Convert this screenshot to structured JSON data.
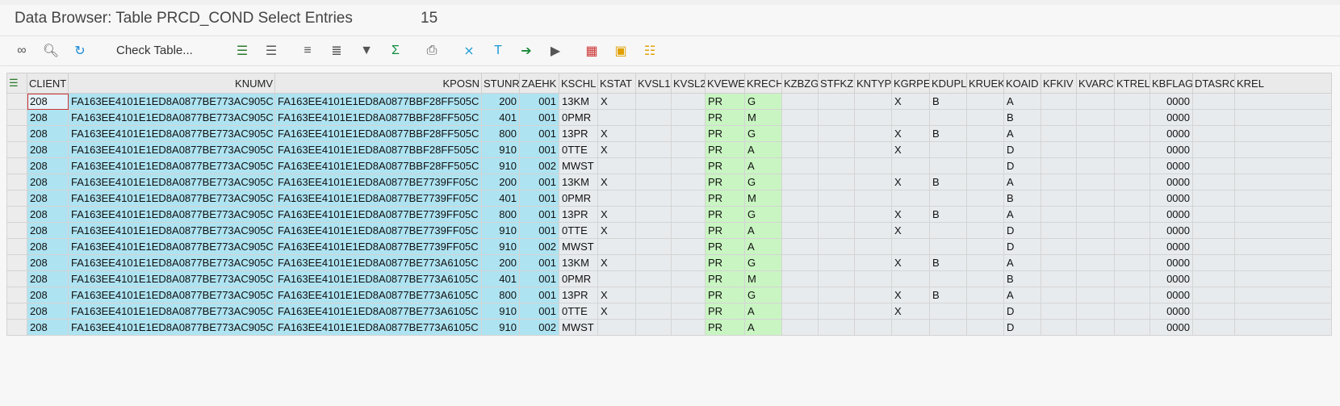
{
  "header": {
    "title": "Data Browser: Table PRCD_COND Select Entries",
    "count": "15"
  },
  "toolbar": {
    "check_table_label": "Check Table...",
    "icons": [
      "glasses-icon",
      "select-document-icon",
      "refresh-icon",
      "select-layout-icon",
      "choose-detail-icon",
      "sort-ascending-icon",
      "sort-descending-icon",
      "filter-icon",
      "sum-icon",
      "print-icon",
      "export-excel-icon",
      "word-processing-icon",
      "local-file-icon",
      "abc-analysis-icon",
      "layout-grid-icon",
      "key-columns-icon",
      "hierarchy-icon"
    ]
  },
  "table": {
    "columns": [
      "CLIENT",
      "KNUMV",
      "KPOSN",
      "STUNR",
      "ZAEHK",
      "KSCHL",
      "KSTAT",
      "KVSL1",
      "KVSL2",
      "KVEWE",
      "KRECH",
      "KZBZG",
      "STFKZ",
      "KNTYP",
      "KGRPE",
      "KDUPL",
      "KRUEK",
      "KOAID",
      "KFKIV",
      "KVARC",
      "KTREL",
      "KBFLAG",
      "DTASRC",
      "KREL"
    ],
    "rows": [
      [
        "208",
        "FA163EE4101E1ED8A0877BE773AC905C",
        "FA163EE4101E1ED8A0877BBF28FF505C",
        "200",
        "001",
        "13KM",
        "X",
        "",
        "",
        "PR",
        "G",
        "",
        "",
        "",
        "X",
        "B",
        "",
        "A",
        "",
        "",
        "",
        "0000",
        "",
        ""
      ],
      [
        "208",
        "FA163EE4101E1ED8A0877BE773AC905C",
        "FA163EE4101E1ED8A0877BBF28FF505C",
        "401",
        "001",
        "0PMR",
        "",
        "",
        "",
        "PR",
        "M",
        "",
        "",
        "",
        "",
        "",
        "",
        "B",
        "",
        "",
        "",
        "0000",
        "",
        ""
      ],
      [
        "208",
        "FA163EE4101E1ED8A0877BE773AC905C",
        "FA163EE4101E1ED8A0877BBF28FF505C",
        "800",
        "001",
        "13PR",
        "X",
        "",
        "",
        "PR",
        "G",
        "",
        "",
        "",
        "X",
        "B",
        "",
        "A",
        "",
        "",
        "",
        "0000",
        "",
        ""
      ],
      [
        "208",
        "FA163EE4101E1ED8A0877BE773AC905C",
        "FA163EE4101E1ED8A0877BBF28FF505C",
        "910",
        "001",
        "0TTE",
        "X",
        "",
        "",
        "PR",
        "A",
        "",
        "",
        "",
        "X",
        "",
        "",
        "D",
        "",
        "",
        "",
        "0000",
        "",
        ""
      ],
      [
        "208",
        "FA163EE4101E1ED8A0877BE773AC905C",
        "FA163EE4101E1ED8A0877BBF28FF505C",
        "910",
        "002",
        "MWST",
        "",
        "",
        "",
        "PR",
        "A",
        "",
        "",
        "",
        "",
        "",
        "",
        "D",
        "",
        "",
        "",
        "0000",
        "",
        ""
      ],
      [
        "208",
        "FA163EE4101E1ED8A0877BE773AC905C",
        "FA163EE4101E1ED8A0877BE7739FF05C",
        "200",
        "001",
        "13KM",
        "X",
        "",
        "",
        "PR",
        "G",
        "",
        "",
        "",
        "X",
        "B",
        "",
        "A",
        "",
        "",
        "",
        "0000",
        "",
        ""
      ],
      [
        "208",
        "FA163EE4101E1ED8A0877BE773AC905C",
        "FA163EE4101E1ED8A0877BE7739FF05C",
        "401",
        "001",
        "0PMR",
        "",
        "",
        "",
        "PR",
        "M",
        "",
        "",
        "",
        "",
        "",
        "",
        "B",
        "",
        "",
        "",
        "0000",
        "",
        ""
      ],
      [
        "208",
        "FA163EE4101E1ED8A0877BE773AC905C",
        "FA163EE4101E1ED8A0877BE7739FF05C",
        "800",
        "001",
        "13PR",
        "X",
        "",
        "",
        "PR",
        "G",
        "",
        "",
        "",
        "X",
        "B",
        "",
        "A",
        "",
        "",
        "",
        "0000",
        "",
        ""
      ],
      [
        "208",
        "FA163EE4101E1ED8A0877BE773AC905C",
        "FA163EE4101E1ED8A0877BE7739FF05C",
        "910",
        "001",
        "0TTE",
        "X",
        "",
        "",
        "PR",
        "A",
        "",
        "",
        "",
        "X",
        "",
        "",
        "D",
        "",
        "",
        "",
        "0000",
        "",
        ""
      ],
      [
        "208",
        "FA163EE4101E1ED8A0877BE773AC905C",
        "FA163EE4101E1ED8A0877BE7739FF05C",
        "910",
        "002",
        "MWST",
        "",
        "",
        "",
        "PR",
        "A",
        "",
        "",
        "",
        "",
        "",
        "",
        "D",
        "",
        "",
        "",
        "0000",
        "",
        ""
      ],
      [
        "208",
        "FA163EE4101E1ED8A0877BE773AC905C",
        "FA163EE4101E1ED8A0877BE773A6105C",
        "200",
        "001",
        "13KM",
        "X",
        "",
        "",
        "PR",
        "G",
        "",
        "",
        "",
        "X",
        "B",
        "",
        "A",
        "",
        "",
        "",
        "0000",
        "",
        ""
      ],
      [
        "208",
        "FA163EE4101E1ED8A0877BE773AC905C",
        "FA163EE4101E1ED8A0877BE773A6105C",
        "401",
        "001",
        "0PMR",
        "",
        "",
        "",
        "PR",
        "M",
        "",
        "",
        "",
        "",
        "",
        "",
        "B",
        "",
        "",
        "",
        "0000",
        "",
        ""
      ],
      [
        "208",
        "FA163EE4101E1ED8A0877BE773AC905C",
        "FA163EE4101E1ED8A0877BE773A6105C",
        "800",
        "001",
        "13PR",
        "X",
        "",
        "",
        "PR",
        "G",
        "",
        "",
        "",
        "X",
        "B",
        "",
        "A",
        "",
        "",
        "",
        "0000",
        "",
        ""
      ],
      [
        "208",
        "FA163EE4101E1ED8A0877BE773AC905C",
        "FA163EE4101E1ED8A0877BE773A6105C",
        "910",
        "001",
        "0TTE",
        "X",
        "",
        "",
        "PR",
        "A",
        "",
        "",
        "",
        "X",
        "",
        "",
        "D",
        "",
        "",
        "",
        "0000",
        "",
        ""
      ],
      [
        "208",
        "FA163EE4101E1ED8A0877BE773AC905C",
        "FA163EE4101E1ED8A0877BE773A6105C",
        "910",
        "002",
        "MWST",
        "",
        "",
        "",
        "PR",
        "A",
        "",
        "",
        "",
        "",
        "",
        "",
        "D",
        "",
        "",
        "",
        "0000",
        "",
        ""
      ]
    ]
  },
  "colors": {
    "key_cell": "#aee3f1",
    "highlight_cell": "#c9f5c2",
    "normal_cell": "#e8ebee",
    "header": "#eaeaea"
  }
}
